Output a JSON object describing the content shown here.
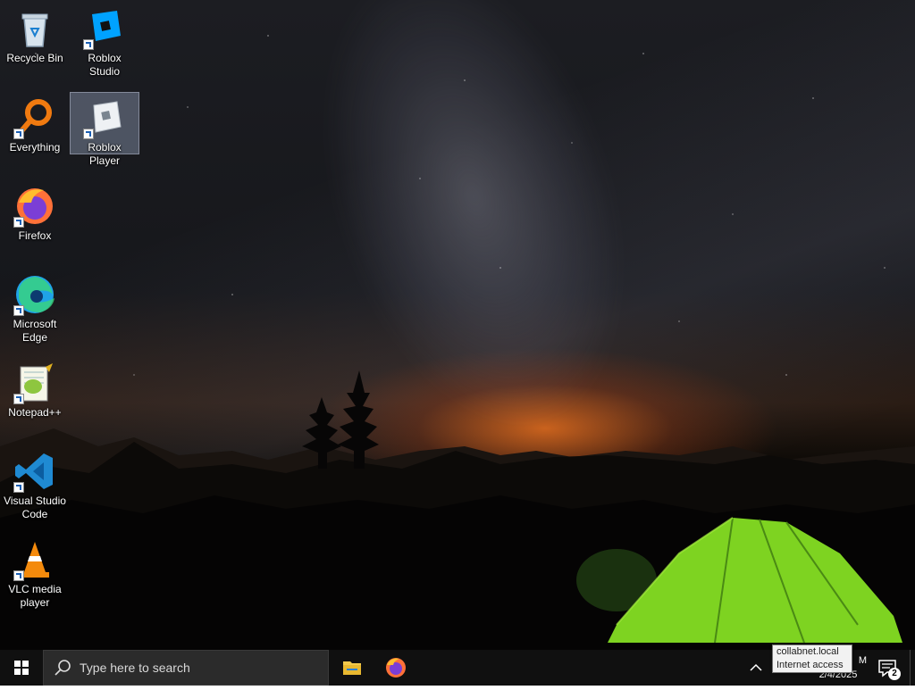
{
  "desktop": {
    "icons": [
      {
        "label": "Recycle Bin",
        "icon": "recycle-bin-icon"
      },
      {
        "label": "Roblox Studio",
        "icon": "roblox-studio-icon"
      },
      {
        "label": "Everything",
        "icon": "everything-search-icon"
      },
      {
        "label": "Roblox Player",
        "icon": "roblox-player-icon",
        "selected": true
      },
      {
        "label": "Firefox",
        "icon": "firefox-icon"
      },
      {
        "label": "Microsoft Edge",
        "icon": "edge-icon"
      },
      {
        "label": "Notepad++",
        "icon": "notepad-plus-plus-icon"
      },
      {
        "label": "Visual Studio Code",
        "icon": "vscode-icon"
      },
      {
        "label": "VLC media player",
        "icon": "vlc-icon"
      }
    ]
  },
  "taskbar": {
    "search_placeholder": "Type here to search",
    "pinned": [
      {
        "name": "File Explorer",
        "icon": "file-explorer-icon"
      },
      {
        "name": "Firefox",
        "icon": "firefox-icon"
      }
    ],
    "clock": {
      "time": "M",
      "date": "2/4/2025"
    },
    "notification_count": "2"
  },
  "tooltip": {
    "line1": "collabnet.local",
    "line2": "Internet access"
  },
  "colors": {
    "taskbar_bg": "#101010",
    "search_bg": "#2b2b2b",
    "accent_blue": "#0078d4",
    "tent_green": "#7ed321"
  }
}
